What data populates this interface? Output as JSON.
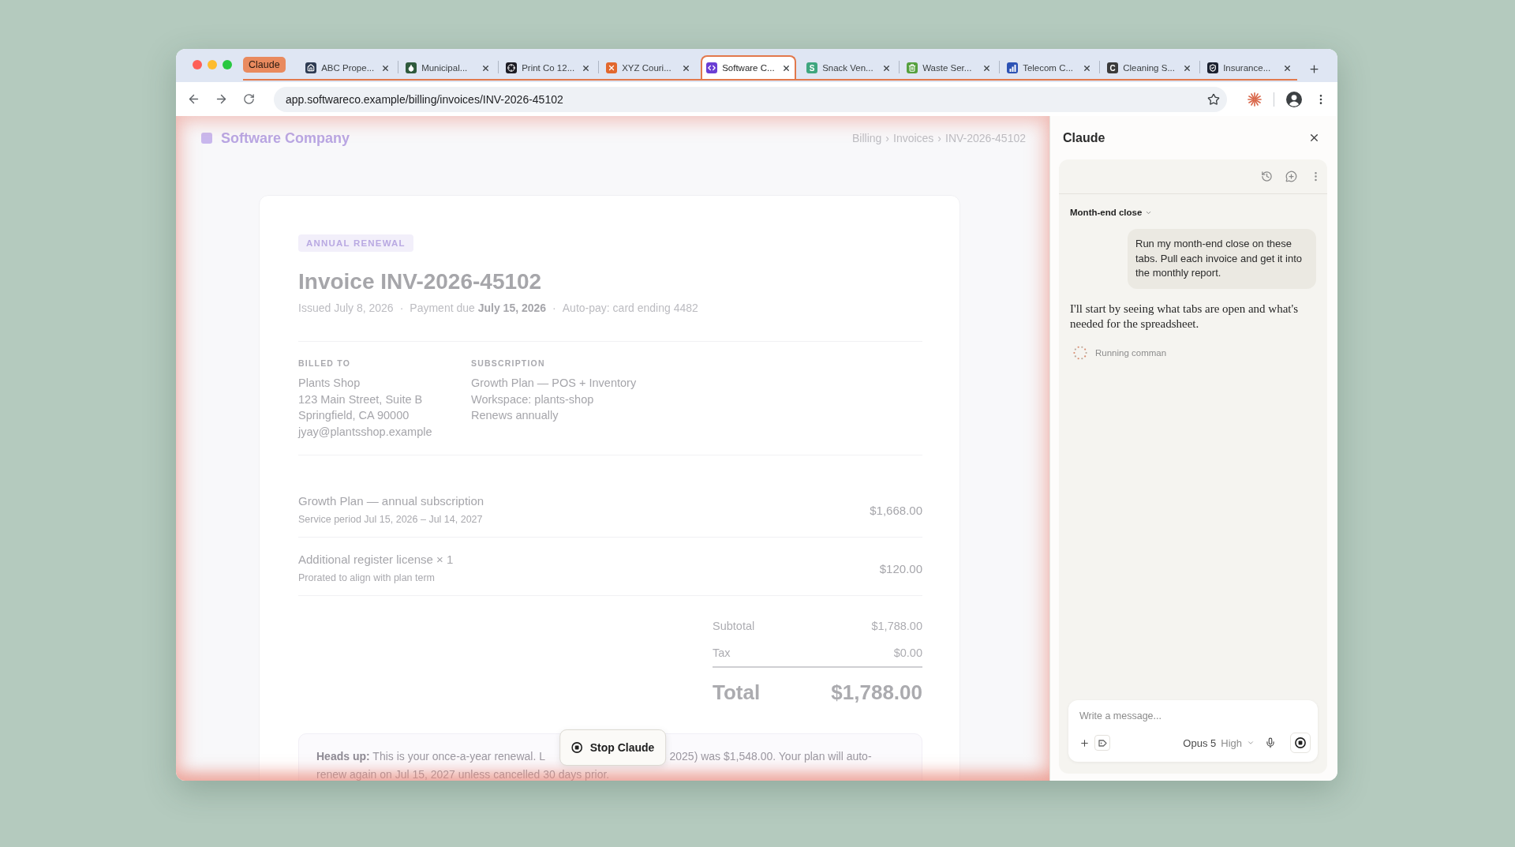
{
  "browser": {
    "tab_group": {
      "label": "Claude"
    },
    "tabs": [
      {
        "title": "ABC Prope...",
        "kind": "house",
        "color": "#2e3b52",
        "selected": false
      },
      {
        "title": "Municipal...",
        "kind": "droplet",
        "color": "#2f5a3c",
        "selected": false
      },
      {
        "title": "Print Co 12...",
        "kind": "crosshair",
        "color": "#1c1c24",
        "selected": false
      },
      {
        "title": "XYZ Couri...",
        "kind": "cross",
        "color": "#e2682e",
        "selected": false
      },
      {
        "title": "Software C...",
        "kind": "code",
        "color": "#6b3fd4",
        "selected": true
      },
      {
        "title": "Snack Ven...",
        "kind": "letter",
        "letter": "S",
        "color": "#3fa67e",
        "selected": false
      },
      {
        "title": "Waste Ser...",
        "kind": "bin",
        "color": "#55a03e",
        "selected": false
      },
      {
        "title": "Telecom C...",
        "kind": "bars",
        "color": "#2d53b5",
        "selected": false
      },
      {
        "title": "Cleaning S...",
        "kind": "letter",
        "letter": "C",
        "color": "#3b3b3b",
        "selected": false
      },
      {
        "title": "Insurance...",
        "kind": "shield",
        "color": "#1b2130",
        "selected": false
      }
    ],
    "url": "app.softwareco.example/billing/invoices/INV-2026-45102"
  },
  "page": {
    "agent_running": true,
    "brand": "Software Company",
    "breadcrumb": {
      "items": [
        "Billing",
        "Invoices",
        "INV-2026-45102"
      ],
      "separator": "›"
    },
    "invoice": {
      "badge": "ANNUAL RENEWAL",
      "title": "Invoice INV-2026-45102",
      "meta": [
        "Issued July 8, 2026",
        "Payment due **July 15, 2026**",
        "Auto-pay: card ending 4482"
      ],
      "meta_separator": "·",
      "billed_to": {
        "label": "BILLED TO",
        "lines": [
          "Plants Shop",
          "123 Main Street, Suite B",
          "Springfield, CA 90000",
          "jyay@plantsshop.example"
        ]
      },
      "subscription": {
        "label": "SUBSCRIPTION",
        "lines": [
          "Growth Plan — POS + Inventory",
          "Workspace: plants-shop",
          "Renews annually"
        ]
      },
      "line_items": [
        {
          "description": "Growth Plan — annual subscription",
          "note": "Service period Jul 15, 2026 – Jul 14, 2027",
          "amount": "$1,668.00"
        },
        {
          "description": "Additional register license × 1",
          "note": "Prorated to align with plan term",
          "amount": "$120.00"
        }
      ],
      "totals": [
        {
          "label": "Subtotal",
          "amount": "$1,788.00"
        },
        {
          "label": "Tax",
          "amount": "$0.00"
        }
      ],
      "total": {
        "label": "Total",
        "amount": "$1,788.00"
      },
      "notice": {
        "segments": [
          "**Heads up:** This is your once-a-year renewal. L",
          "2025) was $1,548.00. Your plan will auto-",
          "renew again on Jul 15, 2027 unless cancelled 30 days prior."
        ]
      }
    },
    "stop_button": {
      "label": "Stop Claude"
    }
  },
  "sidebar": {
    "title": "Claude",
    "conversation": {
      "title": "Month-end close"
    },
    "messages": [
      {
        "kind": "user",
        "text": "Run my month-end close on these tabs. Pull each invoice and get it into the monthly report."
      },
      {
        "kind": "assistant",
        "text": "I'll start by seeing what tabs are open and what's needed for the spreadsheet."
      }
    ],
    "status": "Running comman",
    "composer": {
      "placeholder": "Write a message...",
      "model": "Opus 5",
      "effort": "High"
    }
  }
}
